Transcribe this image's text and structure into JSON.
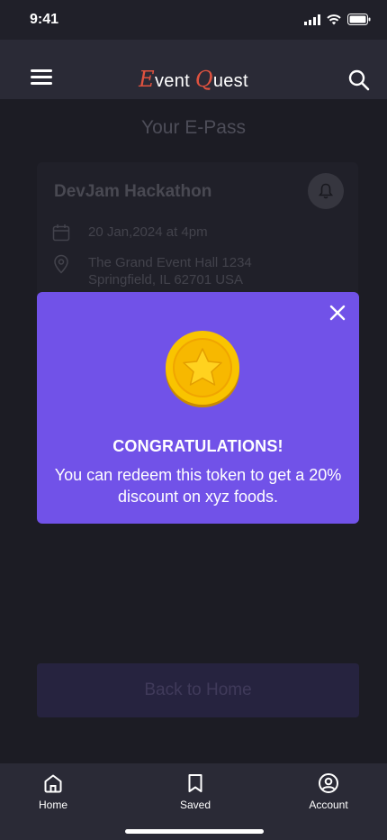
{
  "status_bar": {
    "time": "9:41"
  },
  "header": {
    "title_first_cap": "E",
    "title_first_rest": "vent ",
    "title_second_cap": "Q",
    "title_second_rest": "uest"
  },
  "main": {
    "page_title": "Your E-Pass",
    "event": {
      "name": "DevJam Hackathon",
      "date": "20 Jan,2024 at 4pm",
      "location_line1": "The Grand Event Hall 1234",
      "location_line2": "Springfield, IL 62701 USA"
    },
    "back_home_label": "Back to Home"
  },
  "modal": {
    "title": "CONGRATULATIONS!",
    "message": "You can redeem this token to get a 20% discount on xyz foods."
  },
  "bottom_nav": {
    "items": [
      {
        "label": "Home",
        "icon": "home-icon"
      },
      {
        "label": "Saved",
        "icon": "bookmark-icon"
      },
      {
        "label": "Account",
        "icon": "account-icon"
      }
    ]
  },
  "colors": {
    "accent": "#7152e8",
    "brand_red": "#e0523f",
    "background": "#202029",
    "coin_gold": "#f4b400"
  }
}
